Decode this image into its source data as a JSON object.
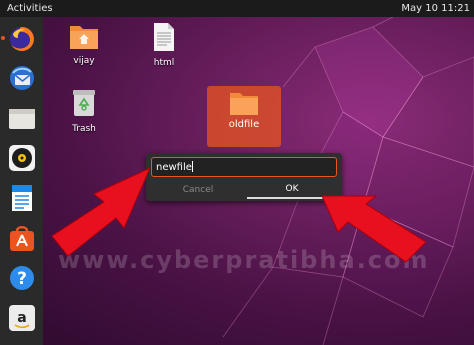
{
  "topbar": {
    "activities": "Activities",
    "clock": "May 10  11:21"
  },
  "dock": [
    "firefox-icon",
    "thunderbird-icon",
    "files-icon",
    "rhythmbox-icon",
    "writer-icon",
    "software-icon",
    "help-icon",
    "amazon-icon"
  ],
  "desktop": {
    "icons": [
      {
        "label": "vijay",
        "icon": "folder-home-icon"
      },
      {
        "label": "html",
        "icon": "text-file-icon"
      },
      {
        "label": "Trash",
        "icon": "trash-icon"
      },
      {
        "label": "oldfile",
        "icon": "folder-icon"
      }
    ]
  },
  "rename": {
    "value": "newfile",
    "cancel": "Cancel",
    "ok": "OK"
  },
  "watermark": "www.cyberpratibha.com",
  "colors": {
    "accent": "#e95420",
    "arrow": "#e8101e",
    "folder": "#f28a3c"
  }
}
